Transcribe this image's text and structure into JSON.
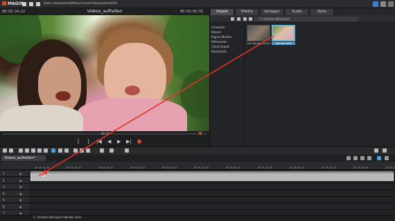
{
  "app": {
    "logo": "MAGIX"
  },
  "menu": [
    "Datei",
    "Bearbeiten",
    "Effekte",
    "Fenster",
    "Bearbeiten",
    "Hilfe"
  ],
  "preview": {
    "timecode_left": "00:03:34:22",
    "title": "Videos_aufhellen",
    "timecode_right": "00:03:45:55",
    "scrub_marker": "00:00",
    "progress": 0.97
  },
  "transport": {
    "buttons": [
      "[",
      "]",
      "|◀",
      "◀",
      "▶",
      "▶|",
      "●"
    ]
  },
  "pool": {
    "tabs": [
      "Import",
      "Effekte",
      "Vorlagen",
      "Audio",
      "Store"
    ],
    "active_tab": "Import",
    "path": "C:\\Videos\\Beispiel",
    "folders": [
      "Computer",
      "Roland",
      "Eigene Medien",
      "Referenzen",
      "Cloud Import",
      "Downloads"
    ],
    "files": [
      {
        "label": "Live Tanning (Link)",
        "selected": false
      },
      {
        "label": "Wunde.m2ts",
        "selected": true
      }
    ]
  },
  "timeline": {
    "tab": "Videos_aufhellen*",
    "ruler": [
      "00:00:00:00",
      "00:00:30:00",
      "00:01:00:00",
      "00:01:30:00",
      "00:02:00:00",
      "00:02:30:00",
      "00:03:00:00",
      "00:03:30:00",
      "00:04:00:00",
      "00:04:30:00",
      "00:05:00:00",
      "00:05:30:00"
    ],
    "tracks": [
      "1",
      "2",
      "3",
      "4",
      "5",
      "6",
      "7"
    ]
  },
  "status": {
    "text": "C:\\Videos\\Beispiel\\Wunde.m2ts"
  },
  "colors": {
    "accent": "#e0452c",
    "selection": "#5fb4e0",
    "arrow": "#e03424"
  }
}
